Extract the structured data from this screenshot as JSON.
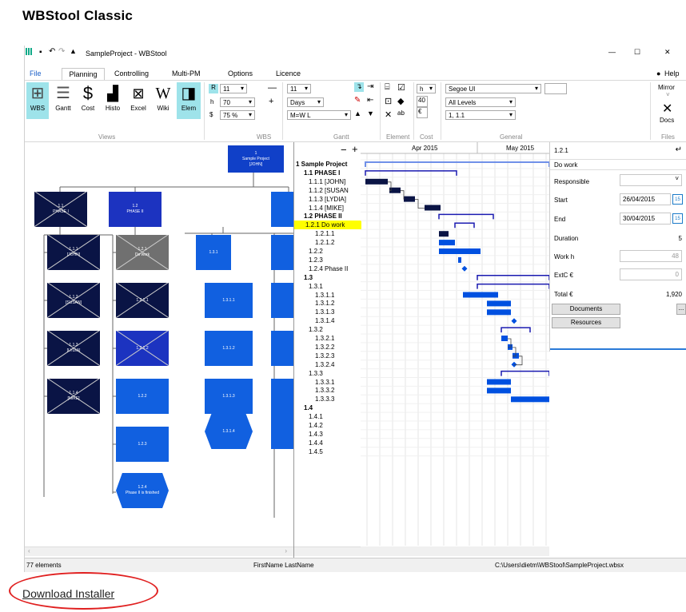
{
  "page": {
    "title": "WBStool Classic",
    "download_link": "Download Installer"
  },
  "window": {
    "title": "SampleProject - WBStool",
    "controls": {
      "minimize": "—",
      "maximize": "☐",
      "close": "✕"
    },
    "menu": [
      {
        "label": "File"
      },
      {
        "label": "Planning"
      },
      {
        "label": "Controlling"
      },
      {
        "label": "Multi-PM"
      },
      {
        "label": "Options"
      },
      {
        "label": "Licence"
      }
    ],
    "help_label": "Help",
    "accent": "#1a1ab0"
  },
  "ribbon": {
    "views": [
      "WBS",
      "Gantt",
      "Cost",
      "Histo",
      "Excel",
      "Wiki",
      "Elem"
    ],
    "groups": [
      "Views",
      "WBS",
      "Gantt",
      "Element",
      "Cost",
      "General",
      "Files"
    ],
    "wbs_fields": {
      "r_label": "R",
      "r_value": "11",
      "h_label": "h",
      "h_value": "70",
      "dollar_label": "$",
      "zoom_value": "75 %"
    },
    "gantt_fields": {
      "size_value": "11",
      "unit_value": "Days",
      "scale_value": "M=W L"
    },
    "cost_fields": {
      "unit_value": "h",
      "value": "40",
      "currency_value": "€"
    },
    "general_fields": {
      "font_value": "Segoe UI",
      "level_value": "All Levels",
      "numbering_value": "1, 1.1"
    },
    "files_fields": {
      "mirror_label": "Mirror",
      "docs_label": "Docs"
    }
  },
  "wbs_nodes": [
    {
      "id": "1",
      "text": "1\nSample Project\n[JOHN]"
    },
    {
      "id": "1.1",
      "text": "1.1\nPHASE I"
    },
    {
      "id": "1.2",
      "text": "1.2\nPHASE II"
    },
    {
      "id": "1.1.1",
      "text": "1.1.1\n[JOHN]"
    },
    {
      "id": "1.1.2",
      "text": "1.1.2\n[SUSAN]"
    },
    {
      "id": "1.1.3",
      "text": "1.1.3\n[LYDIA]"
    },
    {
      "id": "1.1.4",
      "text": "1.1.4\n[MIKE]"
    },
    {
      "id": "1.2.1",
      "text": "1.2.1\nDo work"
    },
    {
      "id": "1.2.1.1",
      "text": "1.2.1.1"
    },
    {
      "id": "1.2.1.2",
      "text": "1.2.1.2"
    },
    {
      "id": "1.2.2",
      "text": "1.2.2"
    },
    {
      "id": "1.2.3",
      "text": "1.2.3"
    },
    {
      "id": "1.2.4",
      "text": "1.2.4\nPhase II is finished"
    },
    {
      "id": "1.3.1",
      "text": "1.3.1"
    },
    {
      "id": "1.3.1.1",
      "text": "1.3.1.1"
    },
    {
      "id": "1.3.1.2",
      "text": "1.3.1.2"
    },
    {
      "id": "1.3.1.3",
      "text": "1.3.1.3"
    },
    {
      "id": "1.3.1.4",
      "text": "1.3.1.4"
    }
  ],
  "gantt": {
    "toolbar": {
      "minus": "−",
      "plus": "+"
    },
    "months": [
      "Apr 2015",
      "May 2015"
    ],
    "rows": [
      "1 Sample Project",
      "1.1 PHASE I",
      "1.1.1 [JOHN]",
      "1.1.2 [SUSAN",
      "1.1.3 [LYDIA]",
      "1.1.4 [MIKE]",
      "1.2 PHASE II",
      "1.2.1 Do work",
      "1.2.1.1",
      "1.2.1.2",
      "1.2.2",
      "1.2.3",
      "1.2.4 Phase II",
      "1.3",
      "1.3.1",
      "1.3.1.1",
      "1.3.1.2",
      "1.3.1.3",
      "1.3.1.4",
      "1.3.2",
      "1.3.2.1",
      "1.3.2.2",
      "1.3.2.3",
      "1.3.2.4",
      "1.3.3",
      "1.3.3.1",
      "1.3.3.2",
      "1.3.3.3",
      "1.4",
      "1.4.1",
      "1.4.2",
      "1.4.3",
      "1.4.4",
      "1.4.5"
    ],
    "colors": {
      "summary": "#1a1ab0",
      "task_dark": "#0a1445",
      "task_blue": "#0050e0",
      "highlight": "#ffff00"
    }
  },
  "properties": {
    "id": "1.2.1",
    "name": "Do work",
    "responsible_label": "Responsible",
    "start_label": "Start",
    "start_value": "26/04/2015",
    "end_label": "End",
    "end_value": "30/04/2015",
    "duration_label": "Duration",
    "duration_value": "5",
    "work_label": "Work h",
    "work_value": "48",
    "extc_label": "ExtC €",
    "extc_value": "0",
    "total_label": "Total €",
    "total_value": "1,920",
    "documents_button": "Documents",
    "resources_button": "Resources",
    "more_button": "...",
    "calendar_label": "15"
  },
  "status": {
    "count": "77 elements",
    "user": "FirstName LastName",
    "path": "C:\\Users\\dietm\\WBStool\\SampleProject.wbsx"
  }
}
